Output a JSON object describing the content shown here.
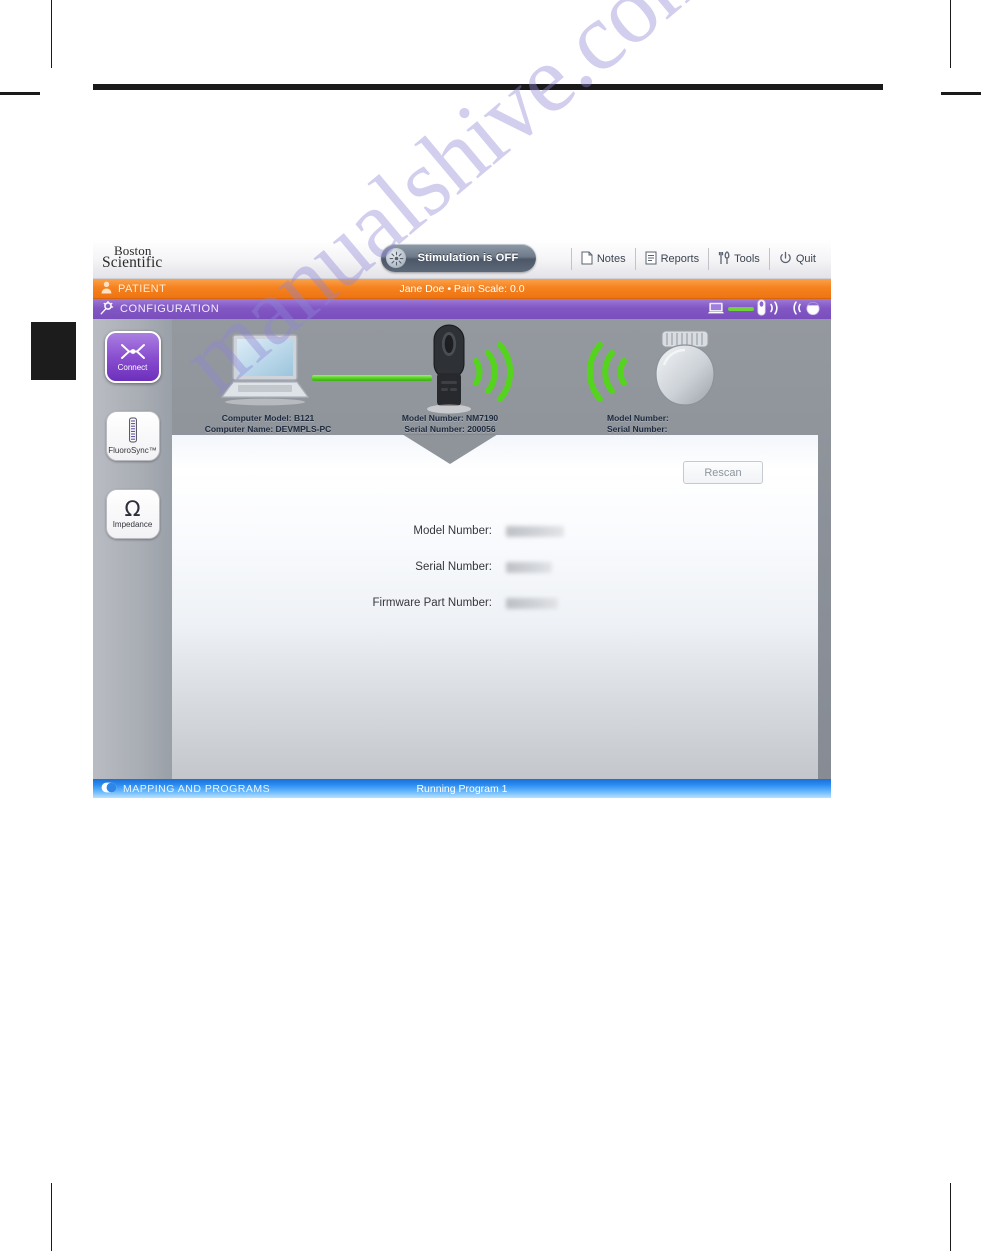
{
  "header": {
    "logo_line1": "Boston",
    "logo_line2": "Scientific",
    "stim_status": "Stimulation is OFF",
    "stim_icon": "sunburst-icon",
    "menu": [
      {
        "label": "Notes",
        "icon": "note-page-icon"
      },
      {
        "label": "Reports",
        "icon": "report-page-icon"
      },
      {
        "label": "Tools",
        "icon": "tools-icon"
      },
      {
        "label": "Quit",
        "icon": "power-icon"
      }
    ]
  },
  "patient_bar": {
    "label": "PATIENT",
    "icon": "person-icon",
    "summary": "Jane Doe  •  Pain Scale: 0.0",
    "color": "#f58220"
  },
  "config_bar": {
    "label": "CONFIGURATION",
    "icon": "wand-gear-icon",
    "color": "#8257c4",
    "status_icons": [
      "laptop-icon",
      "link-line-icon",
      "wand-icon",
      "signal-waves-right-icon",
      "signal-waves-left-icon",
      "ipg-icon"
    ]
  },
  "sidebar": {
    "items": [
      {
        "label": "Connect",
        "icon": "connect-icon",
        "active": true
      },
      {
        "label": "FluoroSync™",
        "icon": "fluorosync-icon",
        "active": false
      },
      {
        "label": "Impedance",
        "icon": "omega-icon",
        "active": false
      }
    ]
  },
  "stage": {
    "computer": {
      "icon": "laptop-icon",
      "line1": "Computer Model: B121",
      "line2": "Computer Name: DEVMPLS-PC"
    },
    "wand": {
      "icon": "wand-icon",
      "line1": "Model Number: NM7190",
      "line2": "Serial Number: 200056"
    },
    "ipg": {
      "icon": "ipg-icon",
      "line1": "Model Number:",
      "line2": "Serial Number:"
    },
    "link_color": "#55cf22"
  },
  "card": {
    "rescan_label": "Rescan",
    "rows": [
      {
        "label": "Model Number:",
        "value": ""
      },
      {
        "label": "Serial Number:",
        "value": ""
      },
      {
        "label": "Firmware Part Number:",
        "value": ""
      }
    ]
  },
  "footer": {
    "label": "MAPPING AND PROGRAMS",
    "icon": "toggle-icon",
    "program": "Running Program 1",
    "color": "#2a8bf0"
  },
  "watermark": {
    "text": "manualshive.com"
  }
}
